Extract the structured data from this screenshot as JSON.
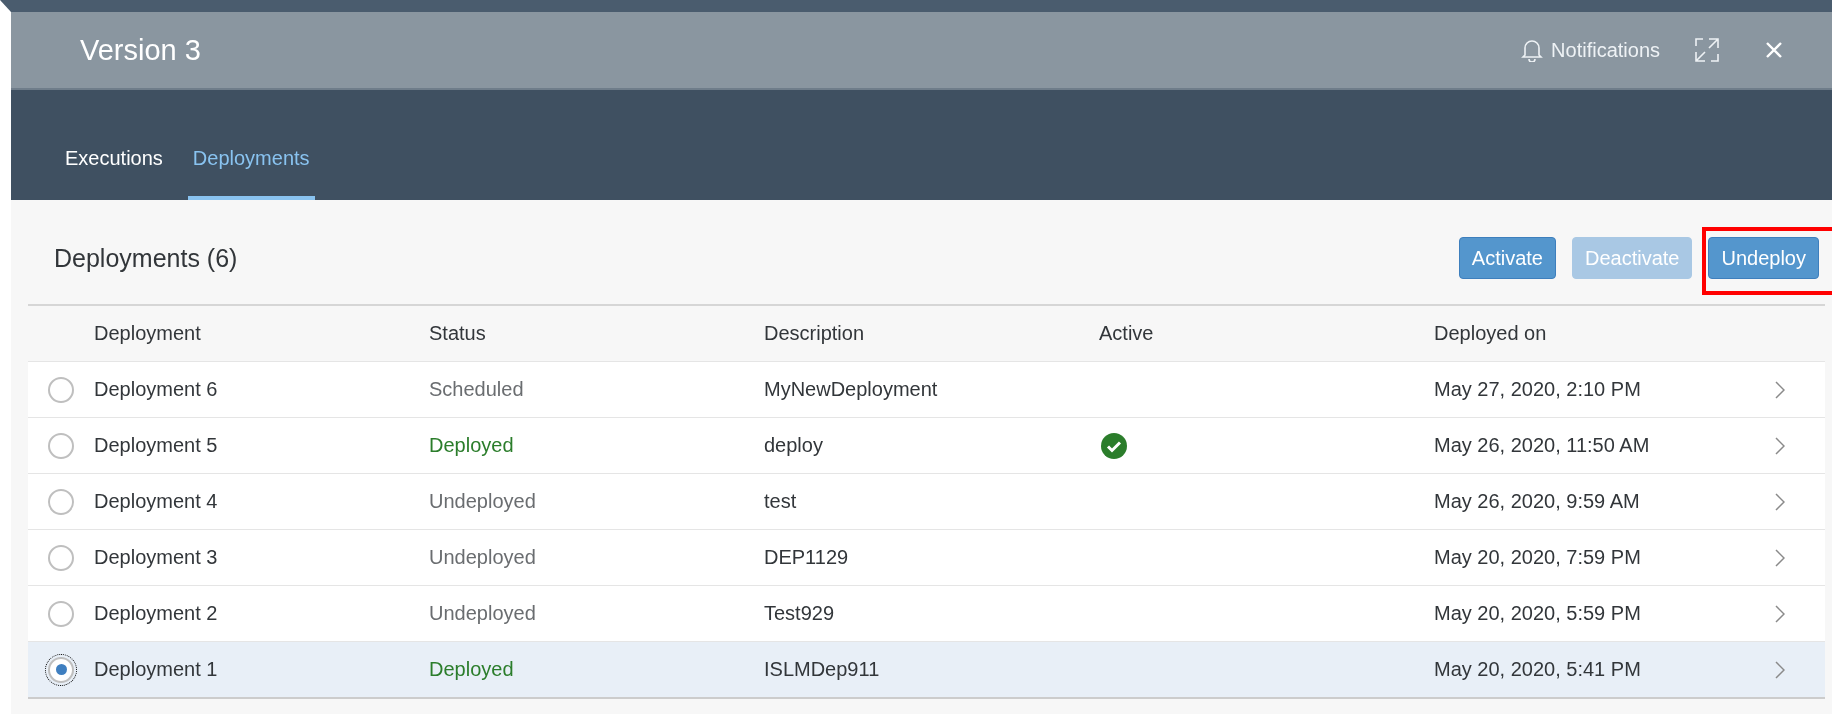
{
  "window": {
    "title": "Version 3",
    "notifications": "Notifications"
  },
  "tabs": [
    {
      "label": "Executions",
      "selected": false
    },
    {
      "label": "Deployments",
      "selected": true
    }
  ],
  "panel": {
    "title": "Deployments (6)",
    "buttons": [
      {
        "label": "Activate",
        "disabled": false,
        "highlighted": false
      },
      {
        "label": "Deactivate",
        "disabled": true,
        "highlighted": false
      },
      {
        "label": "Undeploy",
        "disabled": false,
        "highlighted": true
      }
    ]
  },
  "table": {
    "columns": [
      "Deployment",
      "Status",
      "Description",
      "Active",
      "Deployed on"
    ],
    "rows": [
      {
        "selected": false,
        "name": "Deployment 6",
        "status": "Scheduled",
        "color": "#6a6d70",
        "description": "MyNewDeployment",
        "active": false,
        "deployed_on": "May 27, 2020, 2:10 PM"
      },
      {
        "selected": false,
        "name": "Deployment 5",
        "status": "Deployed",
        "color": "#2b7d2b",
        "description": "deploy",
        "active": true,
        "deployed_on": "May 26, 2020, 11:50 AM"
      },
      {
        "selected": false,
        "name": "Deployment 4",
        "status": "Undeployed",
        "color": "#6a6d70",
        "description": "test",
        "active": false,
        "deployed_on": "May 26, 2020, 9:59 AM"
      },
      {
        "selected": false,
        "name": "Deployment 3",
        "status": "Undeployed",
        "color": "#6a6d70",
        "description": "DEP1129",
        "active": false,
        "deployed_on": "May 20, 2020, 7:59 PM"
      },
      {
        "selected": false,
        "name": "Deployment 2",
        "status": "Undeployed",
        "color": "#6a6d70",
        "description": "Test929",
        "active": false,
        "deployed_on": "May 20, 2020, 5:59 PM"
      },
      {
        "selected": true,
        "name": "Deployment 1",
        "status": "Deployed",
        "color": "#2b7d2b",
        "description": "ISLMDep911",
        "active": false,
        "deployed_on": "May 20, 2020, 5:41 PM"
      }
    ]
  }
}
